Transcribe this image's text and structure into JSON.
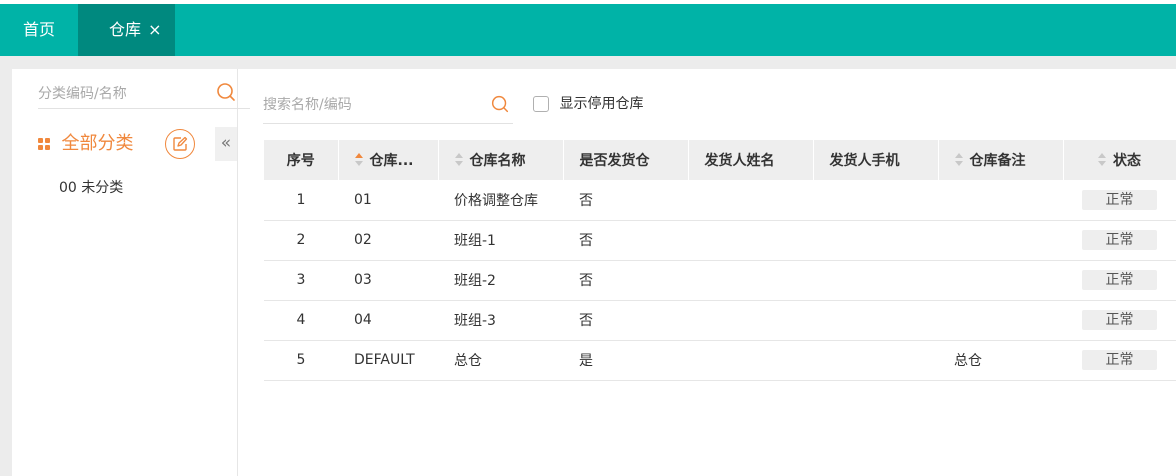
{
  "tabs": [
    {
      "label": "首页"
    },
    {
      "label": "仓库",
      "close": "×"
    }
  ],
  "sidebar": {
    "search_placeholder": "分类编码/名称",
    "category_all": "全部分类",
    "collapse_glyph": "«",
    "items": [
      {
        "label": "00 未分类"
      }
    ]
  },
  "main": {
    "search_placeholder": "搜索名称/编码",
    "show_disabled_label": "显示停用仓库"
  },
  "table": {
    "columns": [
      "序号",
      "仓库...",
      "仓库名称",
      "是否发货仓",
      "发货人姓名",
      "发货人手机",
      "仓库备注",
      "状态"
    ],
    "rows": [
      {
        "no": "1",
        "code": "01",
        "name": "价格调整仓库",
        "ship": "否",
        "sender": "",
        "phone": "",
        "remark": "",
        "status": "正常"
      },
      {
        "no": "2",
        "code": "02",
        "name": "班组-1",
        "ship": "否",
        "sender": "",
        "phone": "",
        "remark": "",
        "status": "正常"
      },
      {
        "no": "3",
        "code": "03",
        "name": "班组-2",
        "ship": "否",
        "sender": "",
        "phone": "",
        "remark": "",
        "status": "正常"
      },
      {
        "no": "4",
        "code": "04",
        "name": "班组-3",
        "ship": "否",
        "sender": "",
        "phone": "",
        "remark": "",
        "status": "正常"
      },
      {
        "no": "5",
        "code": "DEFAULT",
        "name": "总仓",
        "ship": "是",
        "sender": "",
        "phone": "",
        "remark": "总仓",
        "status": "正常"
      }
    ]
  },
  "colors": {
    "primary": "#00b3a7",
    "primary_dark": "#00897f",
    "accent": "#f0883d"
  },
  "icons": [
    "search-icon",
    "grid-icon",
    "edit-icon",
    "sort-icon"
  ]
}
